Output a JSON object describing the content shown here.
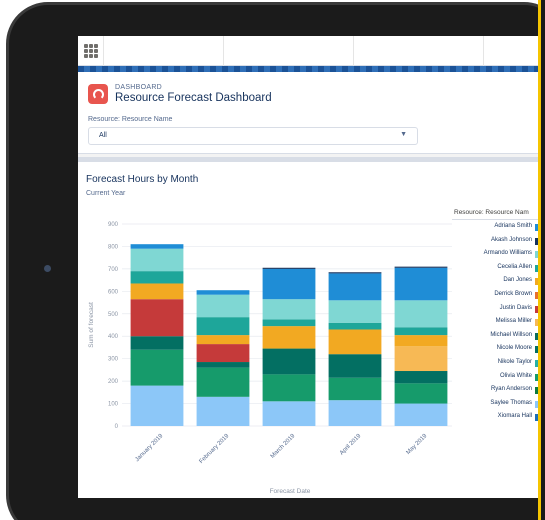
{
  "topbar": {
    "menu_icon": "app-launcher-icon"
  },
  "header": {
    "eyebrow": "DASHBOARD",
    "title": "Resource Forecast Dashboard",
    "filter_label": "Resource: Resource Name",
    "filter_value": "All",
    "filter_caret": "▼"
  },
  "card": {
    "title": "Forecast Hours by Month",
    "subtitle": "Current Year"
  },
  "legend": {
    "title": "Resource: Resource Nam",
    "items": [
      {
        "label": "Adriana Smith",
        "color": "#1f8dd6"
      },
      {
        "label": "Akash Johnson",
        "color": "#16325c"
      },
      {
        "label": "Armando Williams",
        "color": "#7fd7d3"
      },
      {
        "label": "Cecelia Allen",
        "color": "#1ea69a"
      },
      {
        "label": "Dan Jones",
        "color": "#f2a922"
      },
      {
        "label": "Derrick Brown",
        "color": "#e8712e"
      },
      {
        "label": "Justin Davis",
        "color": "#c53a3a"
      },
      {
        "label": "Melissa Miller",
        "color": "#f7b955"
      },
      {
        "label": "Michael Willson",
        "color": "#0a6d5c"
      },
      {
        "label": "Nicole Moore",
        "color": "#036f62"
      },
      {
        "label": "Nikole Taylor",
        "color": "#28b1a6"
      },
      {
        "label": "Olivia White",
        "color": "#169b6b"
      },
      {
        "label": "Ryan Anderson",
        "color": "#0d7a3d"
      },
      {
        "label": "Saylee Thomas",
        "color": "#8cc7f8"
      },
      {
        "label": "Xiomara Hall",
        "color": "#1b6fb8"
      }
    ]
  },
  "chart_data": {
    "type": "bar",
    "stacked": true,
    "title": "Forecast Hours by Month",
    "subtitle": "Current Year",
    "xlabel": "Forecast Date",
    "ylabel": "Sum of forecast",
    "ylim": [
      0,
      900
    ],
    "yticks": [
      "0",
      "100",
      "200",
      "300",
      "400",
      "500",
      "600",
      "700",
      "800",
      "900"
    ],
    "categories": [
      "January 2019",
      "February 2019",
      "March 2019",
      "April 2019",
      "May 2019"
    ],
    "grid": true,
    "legend_position": "right",
    "series": [
      {
        "name": "Saylee Thomas",
        "color": "#8cc7f8",
        "values": [
          180,
          130,
          110,
          115,
          100
        ]
      },
      {
        "name": "Olivia White",
        "color": "#169b6b",
        "values": [
          160,
          130,
          120,
          100,
          90
        ]
      },
      {
        "name": "Nicole Moore",
        "color": "#036f62",
        "values": [
          60,
          25,
          115,
          105,
          55
        ]
      },
      {
        "name": "Justin Davis",
        "color": "#c53a3a",
        "values": [
          165,
          80,
          0,
          0,
          0
        ]
      },
      {
        "name": "Melissa Miller",
        "color": "#f7b955",
        "values": [
          0,
          0,
          0,
          0,
          110
        ]
      },
      {
        "name": "Dan Jones",
        "color": "#f2a922",
        "values": [
          70,
          40,
          100,
          110,
          50
        ]
      },
      {
        "name": "Cecelia Allen",
        "color": "#1ea69a",
        "values": [
          55,
          80,
          30,
          30,
          35
        ]
      },
      {
        "name": "Armando Williams",
        "color": "#7fd7d3",
        "values": [
          100,
          100,
          90,
          100,
          120
        ]
      },
      {
        "name": "Adriana Smith",
        "color": "#1f8dd6",
        "values": [
          20,
          20,
          135,
          120,
          145
        ]
      },
      {
        "name": "Akash Johnson",
        "color": "#16325c",
        "values": [
          0,
          0,
          5,
          5,
          5
        ]
      }
    ]
  }
}
